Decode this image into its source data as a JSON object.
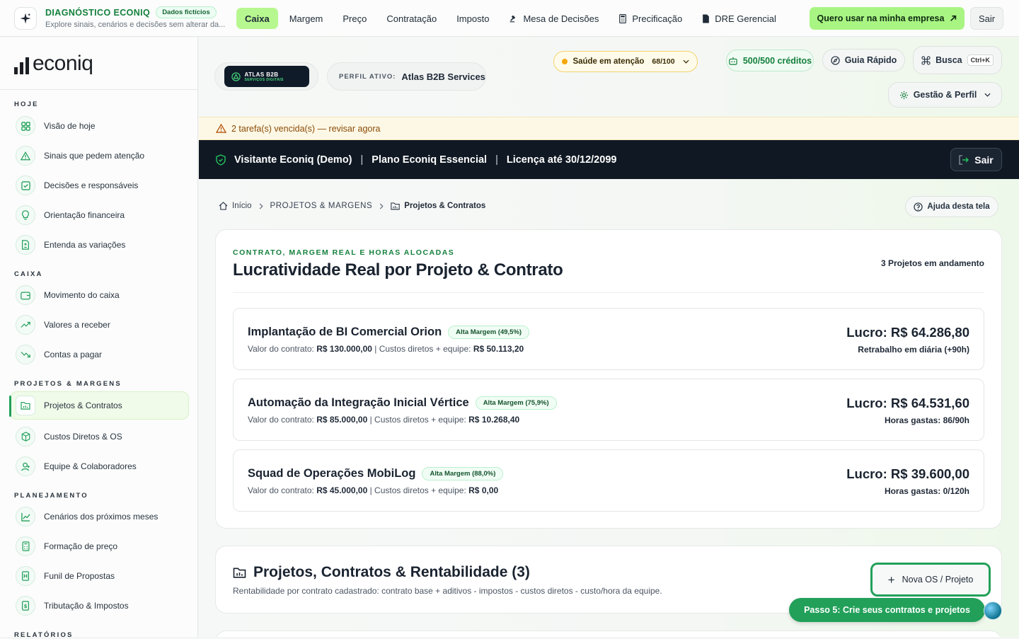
{
  "topbar": {
    "diag_title": "DIAGNÓSTICO ECONIQ",
    "diag_badge": "Dados fictícios",
    "diag_sub": "Explore sinais, cenários e decisões sem alterar da...",
    "nav": [
      {
        "label": "Caixa",
        "icon": "",
        "active": true
      },
      {
        "label": "Margem",
        "icon": ""
      },
      {
        "label": "Preço",
        "icon": ""
      },
      {
        "label": "Contratação",
        "icon": ""
      },
      {
        "label": "Imposto",
        "icon": ""
      },
      {
        "label": "Mesa de Decisões",
        "icon": "gavel-icon"
      },
      {
        "label": "Precificação",
        "icon": "calculator-icon"
      },
      {
        "label": "DRE Gerencial",
        "icon": "document-icon"
      }
    ],
    "cta": "Quero usar na minha empresa",
    "sair": "Sair"
  },
  "sidebar": {
    "brand": "econiq",
    "sections": [
      {
        "title": "HOJE",
        "items": [
          {
            "label": "Visão de hoje",
            "icon": "grid-icon"
          },
          {
            "label": "Sinais que pedem atenção",
            "icon": "warning-icon"
          },
          {
            "label": "Decisões e responsáveis",
            "icon": "checklist-icon"
          },
          {
            "label": "Orientação financeira",
            "icon": "lightbulb-icon"
          },
          {
            "label": "Entenda as variações",
            "icon": "file-diff-icon"
          }
        ]
      },
      {
        "title": "CAIXA",
        "items": [
          {
            "label": "Movimento do caixa",
            "icon": "wallet-icon"
          },
          {
            "label": "Valores a receber",
            "icon": "trend-up-icon"
          },
          {
            "label": "Contas a pagar",
            "icon": "trend-down-icon"
          }
        ]
      },
      {
        "title": "PROJETOS & MARGENS",
        "items": [
          {
            "label": "Projetos & Contratos",
            "icon": "folder-chart-icon",
            "active": true
          },
          {
            "label": "Custos Diretos & OS",
            "icon": "package-icon"
          },
          {
            "label": "Equipe & Colaboradores",
            "icon": "user-icon"
          }
        ]
      },
      {
        "title": "PLANEJAMENTO",
        "items": [
          {
            "label": "Cenários dos próximos meses",
            "icon": "line-chart-icon"
          },
          {
            "label": "Formação de preço",
            "icon": "calculator-icon"
          },
          {
            "label": "Funil de Propostas",
            "icon": "funnel-icon"
          },
          {
            "label": "Tributação & Impostos",
            "icon": "receipt-icon"
          }
        ]
      },
      {
        "title": "RELATÓRIOS",
        "items": []
      }
    ]
  },
  "header": {
    "atlas_name": "ATLAS B2B",
    "atlas_sub": "SERVIÇOS DIGITAIS",
    "perfil_label": "PERFIL ATIVO:",
    "perfil_value": "Atlas B2B Services",
    "saude_label": "Saúde em atenção",
    "saude_score": "68/100",
    "creditos": "500/500 créditos",
    "guia": "Guia Rápido",
    "busca": "Busca",
    "busca_kbd": "Ctrl+K",
    "gestao": "Gestão & Perfil"
  },
  "alert": "2 tarefa(s) vencida(s) — revisar agora",
  "license": {
    "user": "Visitante Econiq (Demo)",
    "plan": "Plano Econiq Essencial",
    "validity": "Licença até 30/12/2099",
    "sair": "Sair"
  },
  "breadcrumb": {
    "home": "Início",
    "section": "PROJETOS & MARGENS",
    "current": "Projetos & Contratos",
    "help": "Ajuda desta tela"
  },
  "summary": {
    "eyebrow": "CONTRATO, MARGEM REAL E HORAS ALOCADAS",
    "title": "Lucratividade Real por Projeto & Contrato",
    "count": "3 Projetos em andamento",
    "projects": [
      {
        "name": "Implantação de BI Comercial Orion",
        "tag": "Alta Margem (49,5%)",
        "valor_label": "Valor do contrato:",
        "valor": "R$ 130.000,00",
        "custos_label": "| Custos diretos + equipe:",
        "custos": "R$ 50.113,20",
        "lucro": "Lucro: R$ 64.286,80",
        "sub": "Retrabalho em diária (+90h)"
      },
      {
        "name": "Automação da Integração Inicial Vértice",
        "tag": "Alta Margem (75,9%)",
        "valor_label": "Valor do contrato:",
        "valor": "R$ 85.000,00",
        "custos_label": "| Custos diretos + equipe:",
        "custos": "R$ 10.268,40",
        "lucro": "Lucro: R$ 64.531,60",
        "sub": "Horas gastas: 86/90h"
      },
      {
        "name": "Squad de Operações MobiLog",
        "tag": "Alta Margem (88,0%)",
        "valor_label": "Valor do contrato:",
        "valor": "R$ 45.000,00",
        "custos_label": "| Custos diretos + equipe:",
        "custos": "R$ 0,00",
        "lucro": "Lucro: R$ 39.600,00",
        "sub": "Horas gastas: 0/120h"
      }
    ]
  },
  "contracts": {
    "title": "Projetos, Contratos & Rentabilidade (3)",
    "subtitle": "Rentabilidade por contrato cadastrado: contrato base + aditivos - impostos - custos diretos - custo/hora da equipe.",
    "new_button": "Nova OS / Projeto"
  },
  "tour": {
    "step": "Passo 5: Crie seus contratos e projetos"
  },
  "colors": {
    "accent": "#22a05a",
    "cta": "#a9f583",
    "dark": "#101923",
    "alert_bg": "#fdf8e6"
  }
}
